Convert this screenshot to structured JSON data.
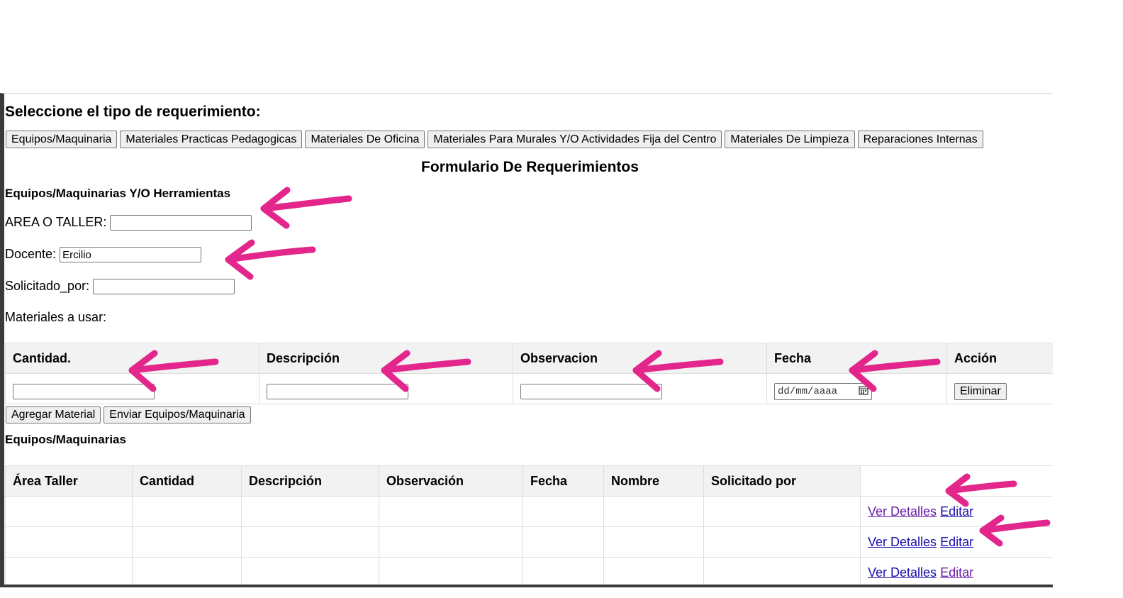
{
  "section_heading": "Seleccione el tipo de requerimiento:",
  "tabs": [
    "Equipos/Maquinaria",
    "Materiales Practicas Pedagogicas",
    "Materiales De Oficina",
    "Materiales Para Murales Y/O Actividades Fija del Centro",
    "Materiales De Limpieza",
    "Reparaciones Internas"
  ],
  "form_title": "Formulario De Requerimientos",
  "form_subtitle": "Equipos/Maquinarias Y/O Herramientas",
  "fields": {
    "area_label": "AREA O TALLER:",
    "area_value": "",
    "docente_label": "Docente:",
    "docente_value": "Ercilio",
    "solicitado_label": "Solicitado_por:",
    "solicitado_value": ""
  },
  "materials_label": "Materiales a usar:",
  "materials_table": {
    "headers": [
      "Cantidad.",
      "Descripción",
      "Observacion",
      "Fecha",
      "Acción"
    ],
    "date_placeholder": "dd/mm/aaaa",
    "delete_label": "Eliminar"
  },
  "actions": {
    "add_material": "Agregar Material",
    "submit": "Enviar Equipos/Maquinaria"
  },
  "list_title": "Equipos/Maquinarias",
  "list_table": {
    "headers": [
      "Área Taller",
      "Cantidad",
      "Descripción",
      "Observación",
      "Fecha",
      "Nombre",
      "Solicitado por",
      ""
    ],
    "rows": [
      {
        "details": "Ver Detalles",
        "edit": "Editar"
      },
      {
        "details": "Ver Detalles",
        "edit": "Editar"
      },
      {
        "details": "Ver Detalles",
        "edit": "Editar"
      }
    ]
  },
  "annotation_color": "#e3268b"
}
